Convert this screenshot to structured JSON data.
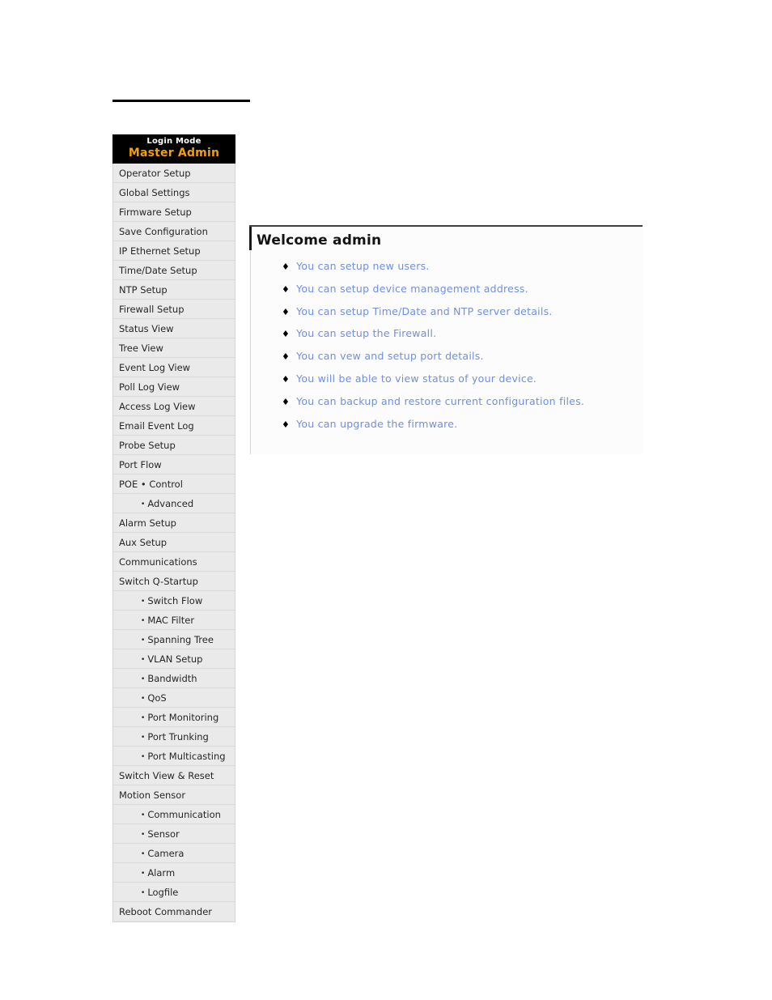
{
  "sidebar": {
    "login_mode_label": "Login Mode",
    "login_mode_value": "Master Admin",
    "items": [
      {
        "label": "Operator Setup",
        "sub": false
      },
      {
        "label": "Global Settings",
        "sub": false
      },
      {
        "label": "Firmware Setup",
        "sub": false
      },
      {
        "label": "Save Configuration",
        "sub": false
      },
      {
        "label": "IP Ethernet Setup",
        "sub": false
      },
      {
        "label": "Time/Date Setup",
        "sub": false
      },
      {
        "label": "NTP Setup",
        "sub": false
      },
      {
        "label": "Firewall Setup",
        "sub": false
      },
      {
        "label": "Status View",
        "sub": false
      },
      {
        "label": "Tree View",
        "sub": false
      },
      {
        "label": "Event Log View",
        "sub": false
      },
      {
        "label": "Poll Log View",
        "sub": false
      },
      {
        "label": "Access Log View",
        "sub": false
      },
      {
        "label": "Email Event Log",
        "sub": false
      },
      {
        "label": "Probe Setup",
        "sub": false
      },
      {
        "label": "Port Flow",
        "sub": false
      },
      {
        "label": "POE • Control",
        "sub": false
      },
      {
        "label": "Advanced",
        "sub": true
      },
      {
        "label": "Alarm Setup",
        "sub": false
      },
      {
        "label": "Aux Setup",
        "sub": false
      },
      {
        "label": "Communications",
        "sub": false
      },
      {
        "label": "Switch Q-Startup",
        "sub": false
      },
      {
        "label": "Switch Flow",
        "sub": true
      },
      {
        "label": "MAC Filter",
        "sub": true
      },
      {
        "label": "Spanning Tree",
        "sub": true
      },
      {
        "label": "VLAN Setup",
        "sub": true
      },
      {
        "label": "Bandwidth",
        "sub": true
      },
      {
        "label": "QoS",
        "sub": true
      },
      {
        "label": "Port Monitoring",
        "sub": true
      },
      {
        "label": "Port Trunking",
        "sub": true
      },
      {
        "label": "Port Multicasting",
        "sub": true
      },
      {
        "label": "Switch View & Reset",
        "sub": false
      },
      {
        "label": "Motion Sensor",
        "sub": false
      },
      {
        "label": "Communication",
        "sub": true
      },
      {
        "label": "Sensor",
        "sub": true
      },
      {
        "label": "Camera",
        "sub": true
      },
      {
        "label": "Alarm",
        "sub": true
      },
      {
        "label": "Logfile",
        "sub": true
      },
      {
        "label": "Reboot Commander",
        "sub": false
      }
    ],
    "sub_bullet": "•"
  },
  "main": {
    "welcome_title": "Welcome admin",
    "bullet": "♦",
    "features": [
      "You can setup new users.",
      "You can setup device management address.",
      "You can setup Time/Date and NTP server details.",
      "You can setup the Firewall.",
      "You can vew and setup port details.",
      "You will be able to view status of your device.",
      "You can backup and restore current configuration files.",
      "You can upgrade the firmware."
    ]
  },
  "colors": {
    "login_mode_accent": "#f2a007",
    "link_blue": "#6f8fe0",
    "nav_background": "#eaeaea",
    "nav_divider": "#d9d9d9"
  }
}
